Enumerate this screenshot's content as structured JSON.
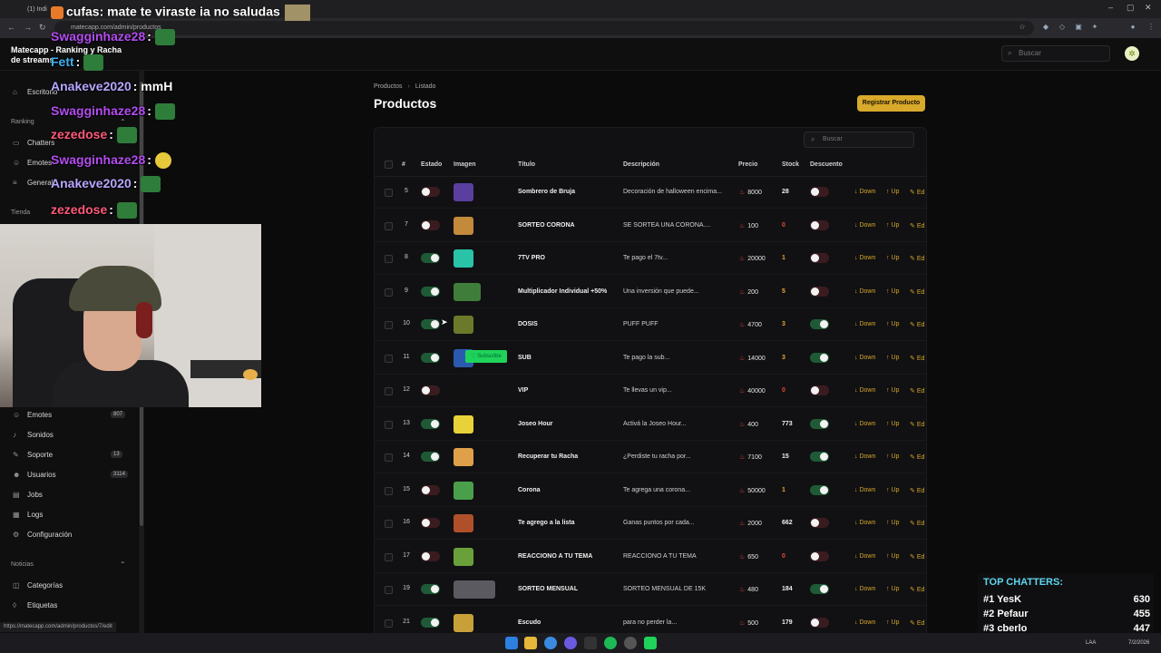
{
  "browser": {
    "tab_label": "(1) Indi",
    "url": "matecapp.com/admin/productos"
  },
  "brand": {
    "line1": "Matecapp - Ranking y Racha",
    "line2": "de streams"
  },
  "header": {
    "search_placeholder": "Buscar"
  },
  "sidebar": {
    "items_top": [
      {
        "label": "Escritorio",
        "icon": "home-icon"
      }
    ],
    "section_ranking": "Ranking",
    "ranking_items": [
      {
        "label": "Chatters",
        "icon": "chat-icon"
      },
      {
        "label": "Emotes",
        "icon": "emote-icon"
      },
      {
        "label": "General",
        "icon": "list-icon"
      }
    ],
    "section_tienda": "Tienda",
    "items_bottom": [
      {
        "label": "Emotes",
        "icon": "emote-icon",
        "badge": "807"
      },
      {
        "label": "Sonidos",
        "icon": "music-icon"
      },
      {
        "label": "Soporte",
        "icon": "support-icon",
        "badge": "13"
      },
      {
        "label": "Usuarios",
        "icon": "users-icon",
        "badge": "3114"
      },
      {
        "label": "Jobs",
        "icon": "jobs-icon"
      },
      {
        "label": "Logs",
        "icon": "logs-icon"
      },
      {
        "label": "Configuración",
        "icon": "gear-icon"
      }
    ],
    "section_noticias": "Noticias",
    "noticias_items": [
      {
        "label": "Categorías",
        "icon": "category-icon"
      },
      {
        "label": "Etiquetas",
        "icon": "tag-icon"
      }
    ]
  },
  "breadcrumb": {
    "parent": "Productos",
    "current": "Listado"
  },
  "page": {
    "title": "Productos",
    "register_button": "Registrar Producto"
  },
  "table": {
    "search_placeholder": "Buscar",
    "headers": {
      "id": "#",
      "estado": "Estado",
      "imagen": "Imagen",
      "titulo": "Título",
      "descripcion": "Descripción",
      "precio": "Precio",
      "stock": "Stock",
      "descuento": "Descuento"
    },
    "actions": {
      "down": "Down",
      "up": "Up",
      "edit": "Ed"
    },
    "rows": [
      {
        "id": "5",
        "estado": false,
        "titulo": "Sombrero de Bruja",
        "descripcion": "Decoración de halloween encima...",
        "precio": "8000",
        "stock": "28",
        "descuento": false,
        "img_color": "#5a3fa0"
      },
      {
        "id": "7",
        "estado": false,
        "titulo": "SORTEO CORONA",
        "descripcion": "SE SORTEA UNA CORONA....",
        "precio": "100",
        "stock": "0",
        "descuento": false,
        "img_color": "#c28a3a"
      },
      {
        "id": "8",
        "estado": true,
        "titulo": "7TV PRO",
        "descripcion": "Te pago el 7tv...",
        "precio": "20000",
        "stock": "1",
        "descuento": false,
        "img_color": "#29c3a8"
      },
      {
        "id": "9",
        "estado": true,
        "titulo": "Multiplicador Individual +50%",
        "descripcion": "Una inversión que puede...",
        "precio": "200",
        "stock": "5",
        "descuento": false,
        "img_color": "#3f7d3a"
      },
      {
        "id": "10",
        "estado": true,
        "titulo": "DOSIS",
        "descripcion": "PUFF PUFF",
        "precio": "4700",
        "stock": "3",
        "descuento": true,
        "img_color": "#6a7a2a"
      },
      {
        "id": "11",
        "estado": true,
        "titulo": "SUB",
        "descripcion": "Te pago la sub...",
        "precio": "14000",
        "stock": "3",
        "descuento": true,
        "img_color": "#2a5ab0"
      },
      {
        "id": "12",
        "estado": false,
        "titulo": "VIP",
        "descripcion": "Te llevas un vip...",
        "precio": "40000",
        "stock": "0",
        "descuento": false,
        "img_color": "#111111"
      },
      {
        "id": "13",
        "estado": true,
        "titulo": "Joseo Hour",
        "descripcion": "Activá la Joseo Hour...",
        "precio": "400",
        "stock": "773",
        "descuento": true,
        "img_color": "#e8d23a"
      },
      {
        "id": "14",
        "estado": true,
        "titulo": "Recuperar tu Racha",
        "descripcion": "¿Perdiste tu racha por...",
        "precio": "7100",
        "stock": "15",
        "descuento": true,
        "img_color": "#e0a04a"
      },
      {
        "id": "15",
        "estado": false,
        "titulo": "Corona",
        "descripcion": "Te agrega una corona...",
        "precio": "50000",
        "stock": "1",
        "descuento": true,
        "img_color": "#4aa04a"
      },
      {
        "id": "16",
        "estado": false,
        "titulo": "Te agrego a la lista",
        "descripcion": "Ganas puntos por cada...",
        "precio": "2000",
        "stock": "662",
        "descuento": false,
        "img_color": "#b0502a"
      },
      {
        "id": "17",
        "estado": false,
        "titulo": "REACCIONO A TU TEMA",
        "descripcion": "REACCIONO A TU TEMA",
        "precio": "650",
        "stock": "0",
        "descuento": false,
        "img_color": "#6aa03a"
      },
      {
        "id": "19",
        "estado": true,
        "titulo": "SORTEO MENSUAL",
        "descripcion": "SORTEO MENSUAL DE 15K",
        "precio": "480",
        "stock": "184",
        "descuento": true,
        "img_color": "#5a5a60"
      },
      {
        "id": "21",
        "estado": true,
        "titulo": "Escudo",
        "descripcion": "para no perder la...",
        "precio": "500",
        "stock": "179",
        "descuento": false,
        "img_color": "#c8a03a"
      }
    ]
  },
  "stream_overlay": {
    "top_message": {
      "nick": "cufas",
      "text": ": mate te viraste ia no saludas"
    },
    "chat": [
      {
        "nick": "Swagginhaze28",
        "text": ":",
        "color": "#b44cf0"
      },
      {
        "nick": "Fett",
        "text": ":",
        "color": "#3fb0f0"
      },
      {
        "nick": "Anakeve2020",
        "text": ": mmH",
        "color": "#b9a6ff"
      },
      {
        "nick": "Swagginhaze28",
        "text": ":",
        "color": "#b44cf0"
      },
      {
        "nick": "zezedose",
        "text": ":",
        "color": "#ff5a7a"
      },
      {
        "nick": "Swagginhaze28",
        "text": ":",
        "color": "#b44cf0"
      },
      {
        "nick": "Anakeve2020",
        "text": ":",
        "color": "#b9a6ff"
      },
      {
        "nick": "zezedose",
        "text": ":",
        "color": "#ff5a7a"
      }
    ],
    "subscribe_label": "Subscribe",
    "top_chatters": {
      "title": "TOP CHATTERS:",
      "entries": [
        {
          "rank": "#1",
          "name": "YesK",
          "count": "630"
        },
        {
          "rank": "#2",
          "name": "Pefaur",
          "count": "455"
        },
        {
          "rank": "#3",
          "name": "cberlo",
          "count": "447"
        }
      ]
    }
  },
  "status_url": "https://matecapp.com/admin/productos/7/edit",
  "taskbar": {
    "lang": "LAA",
    "date": "7/2/2026"
  },
  "colors": {
    "accent": "#d8a92a",
    "toggle_on": "#1f5a36",
    "toggle_off": "#3a1c20",
    "price_icon": "#e24a3b"
  }
}
